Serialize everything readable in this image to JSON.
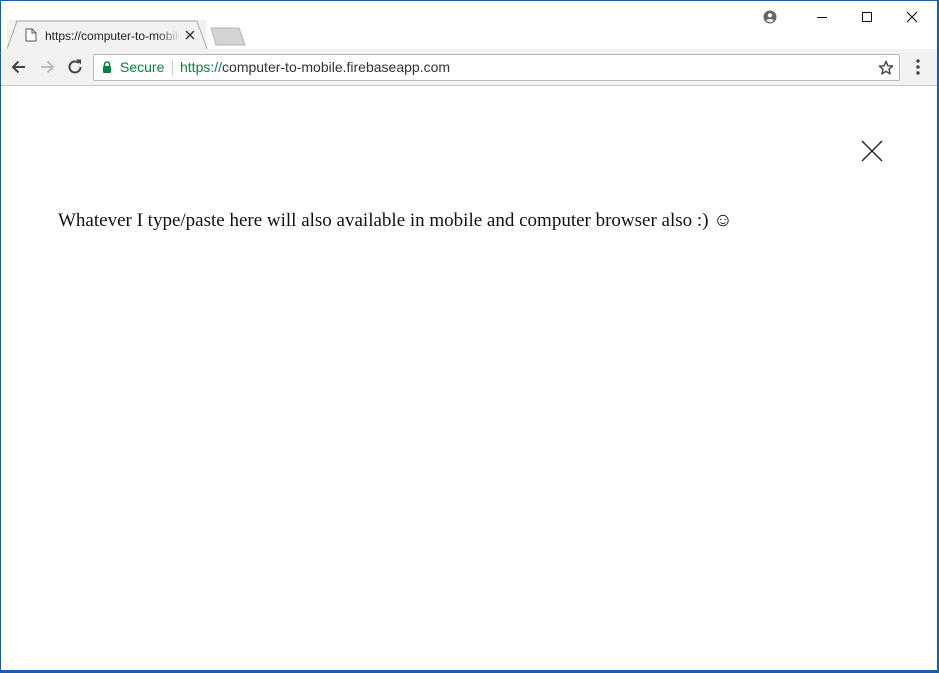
{
  "tab": {
    "title": "https://computer-to-mobile.firebaseapp.com",
    "favicon": "page-icon",
    "close_icon": "close-icon"
  },
  "window_controls": {
    "profile_icon": "profile-icon",
    "minimize_icon": "minimize-icon",
    "maximize_icon": "maximize-icon",
    "close_icon": "close-icon"
  },
  "toolbar": {
    "back_icon": "back-arrow-icon",
    "forward_icon": "forward-arrow-icon",
    "reload_icon": "reload-icon",
    "secure_label": "Secure",
    "url_scheme": "https://",
    "url_rest": "computer-to-mobile.firebaseapp.com",
    "bookmark_icon": "star-icon",
    "menu_icon": "kebab-menu-icon"
  },
  "page": {
    "close_icon": "close-x-icon",
    "message": "Whatever I type/paste here will also available in mobile and computer browser also :) ☺"
  },
  "colors": {
    "frame": "#1c5ca6",
    "secure_green": "#0b8043",
    "toolbar_bg": "#f2f2f2"
  }
}
